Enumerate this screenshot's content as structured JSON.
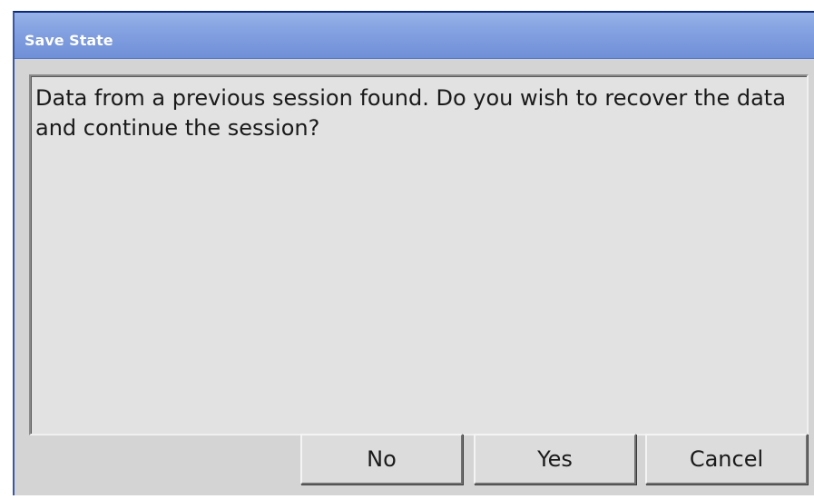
{
  "window": {
    "title": "Save State"
  },
  "message": {
    "text": "Data from a previous session found. Do you wish to recover the data and continue the session?"
  },
  "buttons": {
    "no": "No",
    "yes": "Yes",
    "cancel": "Cancel"
  },
  "colors": {
    "title_bar": "#86a3e2",
    "dialog_background": "#d4d4d4",
    "content_background": "#e2e2e2",
    "button_face": "#dcdcdc"
  }
}
